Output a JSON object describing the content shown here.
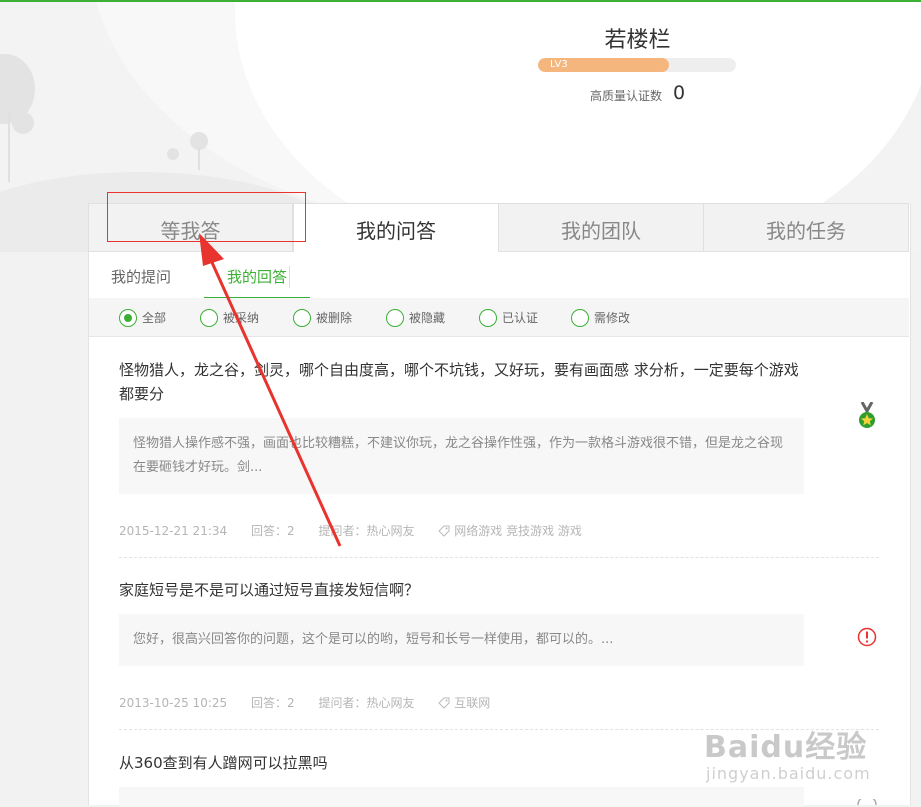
{
  "profile": {
    "username": "若楼栏",
    "level_label": "LV3",
    "level_progress": 0.66,
    "cert_label": "高质量认证数",
    "cert_count": "0"
  },
  "tabs": [
    "等我答",
    "我的问答",
    "我的团队",
    "我的任务"
  ],
  "active_tab": 1,
  "subtabs": [
    "我的提问",
    "我的回答"
  ],
  "active_subtab": 1,
  "filters": [
    "全部",
    "被采纳",
    "被删除",
    "被隐藏",
    "已认证",
    "需修改"
  ],
  "selected_filter": 0,
  "items": [
    {
      "title": "怪物猎人，龙之谷，剑灵，哪个自由度高，哪个不坑钱，又好玩，要有画面感 求分析，一定要每个游戏都要分",
      "excerpt": "怪物猎人操作感不强，画面也比较糟糕，不建议你玩，龙之谷操作性强，作为一款格斗游戏很不错，但是龙之谷现在要砸钱才好玩。剑...",
      "date": "2015-12-21 21:34",
      "answers": "回答：2",
      "asker": "提问者：热心网友",
      "tags": "网络游戏 竞技游戏 游戏",
      "status_icon": "medal-icon"
    },
    {
      "title": "家庭短号是不是可以通过短号直接发短信啊？",
      "excerpt": "您好，很高兴回答你的问题，这个是可以的哟，短号和长号一样使用，都可以的。...",
      "date": "2013-10-25 10:25",
      "answers": "回答：2",
      "asker": "提问者：热心网友",
      "tags": "互联网",
      "status_icon": "warning-icon"
    },
    {
      "title": "从360查到有人蹭网可以拉黑吗"
    }
  ],
  "watermark": {
    "brand": "Baidu经验",
    "url": "jingyan.baidu.com"
  },
  "colors": {
    "accent": "#3cb034",
    "annotation": "#e8332e",
    "level": "#f5b67e"
  }
}
